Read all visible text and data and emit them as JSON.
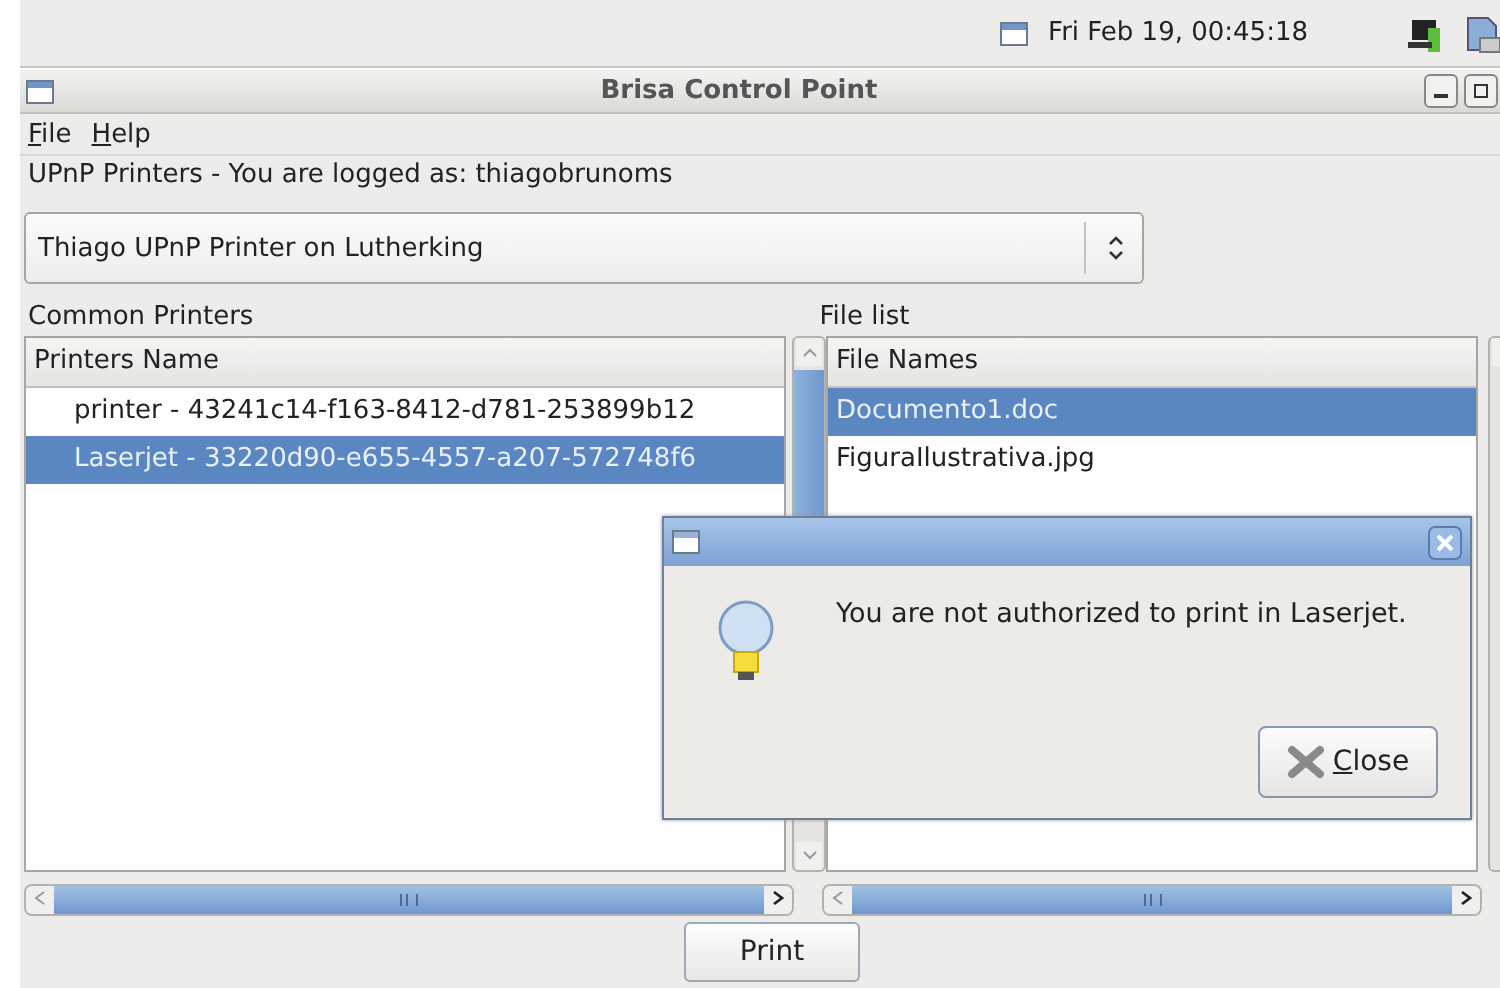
{
  "panel": {
    "clock": "Fri Feb 19, 00:45:18"
  },
  "window": {
    "title": "Brisa Control Point"
  },
  "menu": [
    {
      "label": "File"
    },
    {
      "label": "Help"
    }
  ],
  "login_label": "UPnP Printers - You are logged as: thiagobrunoms",
  "device_combo": {
    "value": "Thiago UPnP Printer on Lutherking"
  },
  "printers": {
    "title": "Common Printers",
    "column": "Printers Name",
    "rows": [
      {
        "label": "printer - 43241c14-f163-8412-d781-253899b12",
        "selected": false
      },
      {
        "label": "Laserjet - 33220d90-e655-4557-a207-572748f6",
        "selected": true
      }
    ]
  },
  "files": {
    "title": "File list",
    "column": "File Names",
    "rows": [
      {
        "label": "Documento1.doc",
        "selected": true
      },
      {
        "label": "FiguraIlustrativa.jpg",
        "selected": false
      }
    ]
  },
  "print_button": "Print",
  "dialog": {
    "message": "You are not authorized to print in Laserjet.",
    "button": "Close"
  }
}
